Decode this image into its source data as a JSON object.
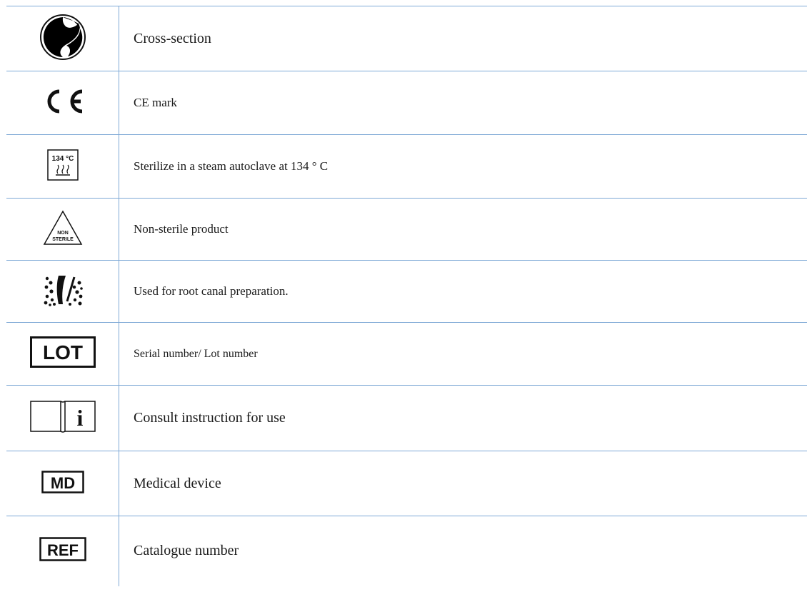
{
  "rows": [
    {
      "icon": "cross-section-icon",
      "label": "Cross-section",
      "size": "20px"
    },
    {
      "icon": "ce-mark-icon",
      "label": "CE mark",
      "size": "17px"
    },
    {
      "icon": "autoclave-134c-icon",
      "icon_text": "134 °C",
      "label": "Sterilize in a steam autoclave at 134 ° C",
      "size": "17px"
    },
    {
      "icon": "non-sterile-icon",
      "icon_text_1": "NON",
      "icon_text_2": "STERILE",
      "label": "Non-sterile product",
      "size": "17px"
    },
    {
      "icon": "root-canal-icon",
      "label": "Used for root canal preparation.",
      "size": "17px"
    },
    {
      "icon": "lot-icon",
      "icon_text": "LOT",
      "label": "Serial number/ Lot number",
      "size": "16px"
    },
    {
      "icon": "consult-instructions-icon",
      "icon_text": "i",
      "label": "Consult instruction for use",
      "size": "20px"
    },
    {
      "icon": "medical-device-icon",
      "icon_text": "MD",
      "label": "Medical device",
      "size": "20px"
    },
    {
      "icon": "ref-icon",
      "icon_text": "REF",
      "label": "Catalogue number",
      "size": "20px"
    }
  ]
}
